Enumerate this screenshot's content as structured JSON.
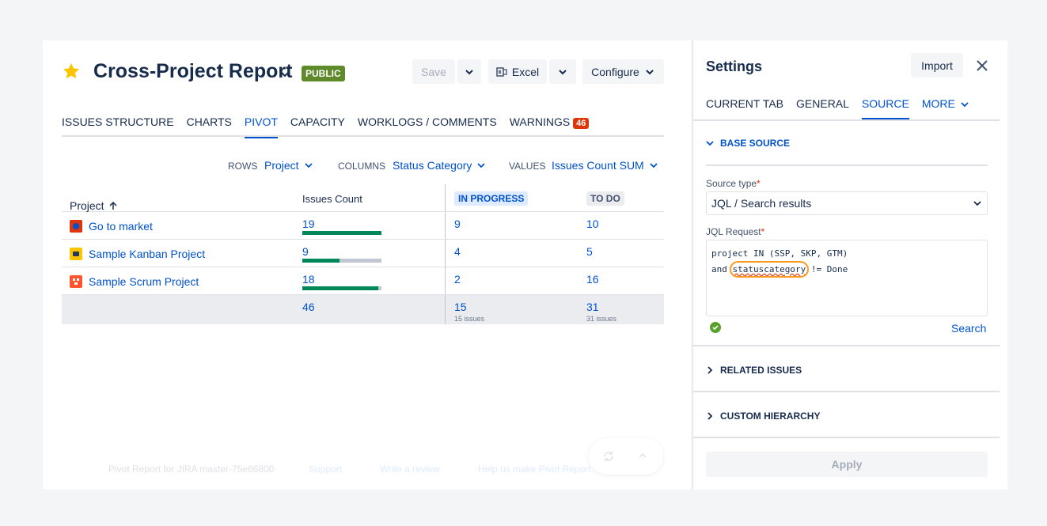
{
  "header": {
    "title": "Cross-Project Report",
    "visibility_badge": "PUBLIC",
    "save_label": "Save",
    "excel_label": "Excel",
    "configure_label": "Configure"
  },
  "tabs": [
    {
      "label": "ISSUES STRUCTURE"
    },
    {
      "label": "CHARTS"
    },
    {
      "label": "PIVOT",
      "active": true
    },
    {
      "label": "CAPACITY"
    },
    {
      "label": "WORKLOGS / COMMENTS"
    },
    {
      "label": "WARNINGS",
      "badge": "46"
    }
  ],
  "pivot_controls": {
    "rows_label": "ROWS",
    "rows_value": "Project",
    "columns_label": "COLUMNS",
    "columns_value": "Status Category",
    "values_label": "VALUES",
    "values_value": "Issues Count SUM"
  },
  "table": {
    "headers": {
      "project": "Project",
      "issues_count": "Issues Count",
      "in_progress": "IN PROGRESS",
      "to_do": "TO DO"
    },
    "rows": [
      {
        "project": "Go to market",
        "count": "19",
        "bar_fill": 1.0,
        "in_progress": "9",
        "to_do": "10"
      },
      {
        "project": "Sample Kanban Project",
        "count": "9",
        "bar_fill": 0.47,
        "in_progress": "4",
        "to_do": "5"
      },
      {
        "project": "Sample Scrum Project",
        "count": "18",
        "bar_fill": 0.96,
        "in_progress": "2",
        "to_do": "16"
      }
    ],
    "total": {
      "count": "46",
      "in_progress": "15",
      "in_progress_sub": "15 issues",
      "to_do": "31",
      "to_do_sub": "31 issues"
    }
  },
  "footer": {
    "version": "Pivot Report for JIRA master-75e66800",
    "support": "Support",
    "review": "Write a review",
    "help": "Help us make Pivot Report"
  },
  "settings": {
    "title": "Settings",
    "import_label": "Import",
    "tabs": [
      {
        "label": "CURRENT TAB"
      },
      {
        "label": "GENERAL"
      },
      {
        "label": "SOURCE",
        "active": true
      },
      {
        "label": "MORE"
      }
    ],
    "base_source": "BASE SOURCE",
    "source_type_label": "Source type",
    "required_mark": "*",
    "source_type_value": "JQL / Search results",
    "jql_label": "JQL Request",
    "jql_line1": "project IN (SSP, SKP, GTM)",
    "jql_line2_pre": "and ",
    "jql_line2_field": "statuscategory",
    "jql_line2_post": " != Done",
    "search_label": "Search",
    "related_issues": "RELATED ISSUES",
    "custom_hierarchy": "CUSTOM HIERARCHY",
    "apply_label": "Apply"
  },
  "colors": {
    "accent": "#0052cc",
    "badge_public": "#5e8a2a",
    "badge_warning": "#de350b",
    "bar_green": "#00875a",
    "highlight": "#ff991f"
  }
}
